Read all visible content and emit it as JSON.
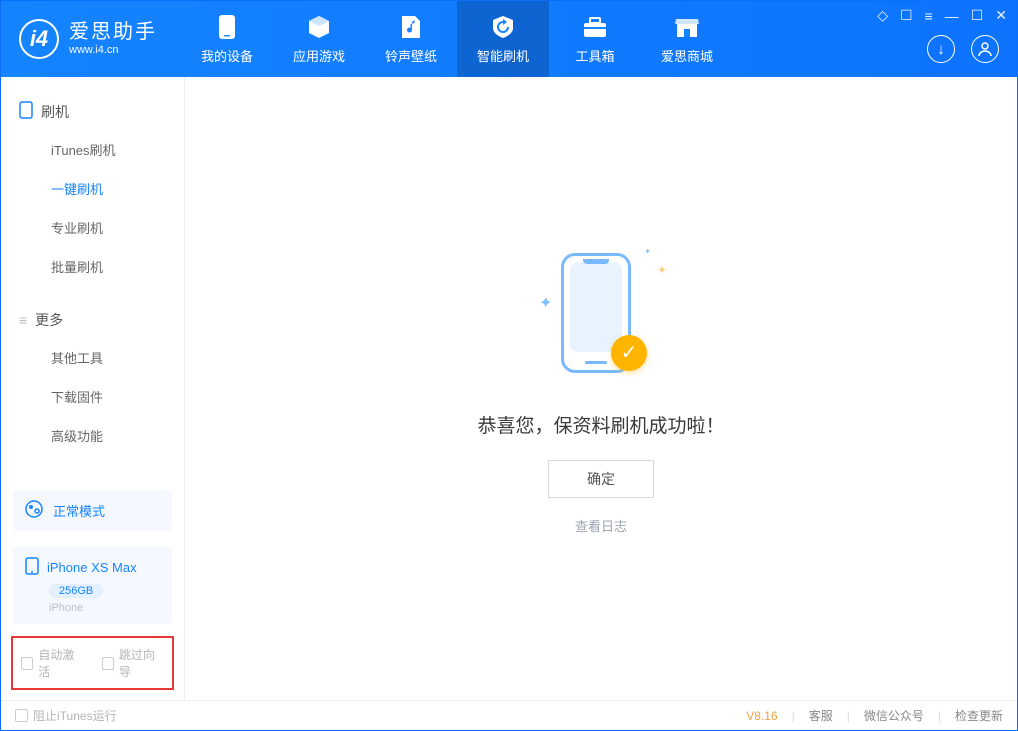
{
  "app": {
    "name": "爱思助手",
    "url": "www.i4.cn"
  },
  "nav": [
    {
      "label": "我的设备"
    },
    {
      "label": "应用游戏"
    },
    {
      "label": "铃声壁纸"
    },
    {
      "label": "智能刷机"
    },
    {
      "label": "工具箱"
    },
    {
      "label": "爱思商城"
    }
  ],
  "sidebar": {
    "section1": {
      "title": "刷机",
      "items": [
        "iTunes刷机",
        "一键刷机",
        "专业刷机",
        "批量刷机"
      ]
    },
    "section2": {
      "title": "更多",
      "items": [
        "其他工具",
        "下载固件",
        "高级功能"
      ]
    }
  },
  "mode_card": {
    "label": "正常模式"
  },
  "device": {
    "name": "iPhone XS Max",
    "capacity": "256GB",
    "type": "iPhone"
  },
  "checks": {
    "auto_activate": "自动激活",
    "skip_guide": "跳过向导"
  },
  "main": {
    "success_msg": "恭喜您，保资料刷机成功啦！",
    "ok": "确定",
    "view_log": "查看日志"
  },
  "statusbar": {
    "block_itunes": "阻止iTunes运行",
    "version": "V8.16",
    "links": [
      "客服",
      "微信公众号",
      "检查更新"
    ]
  }
}
